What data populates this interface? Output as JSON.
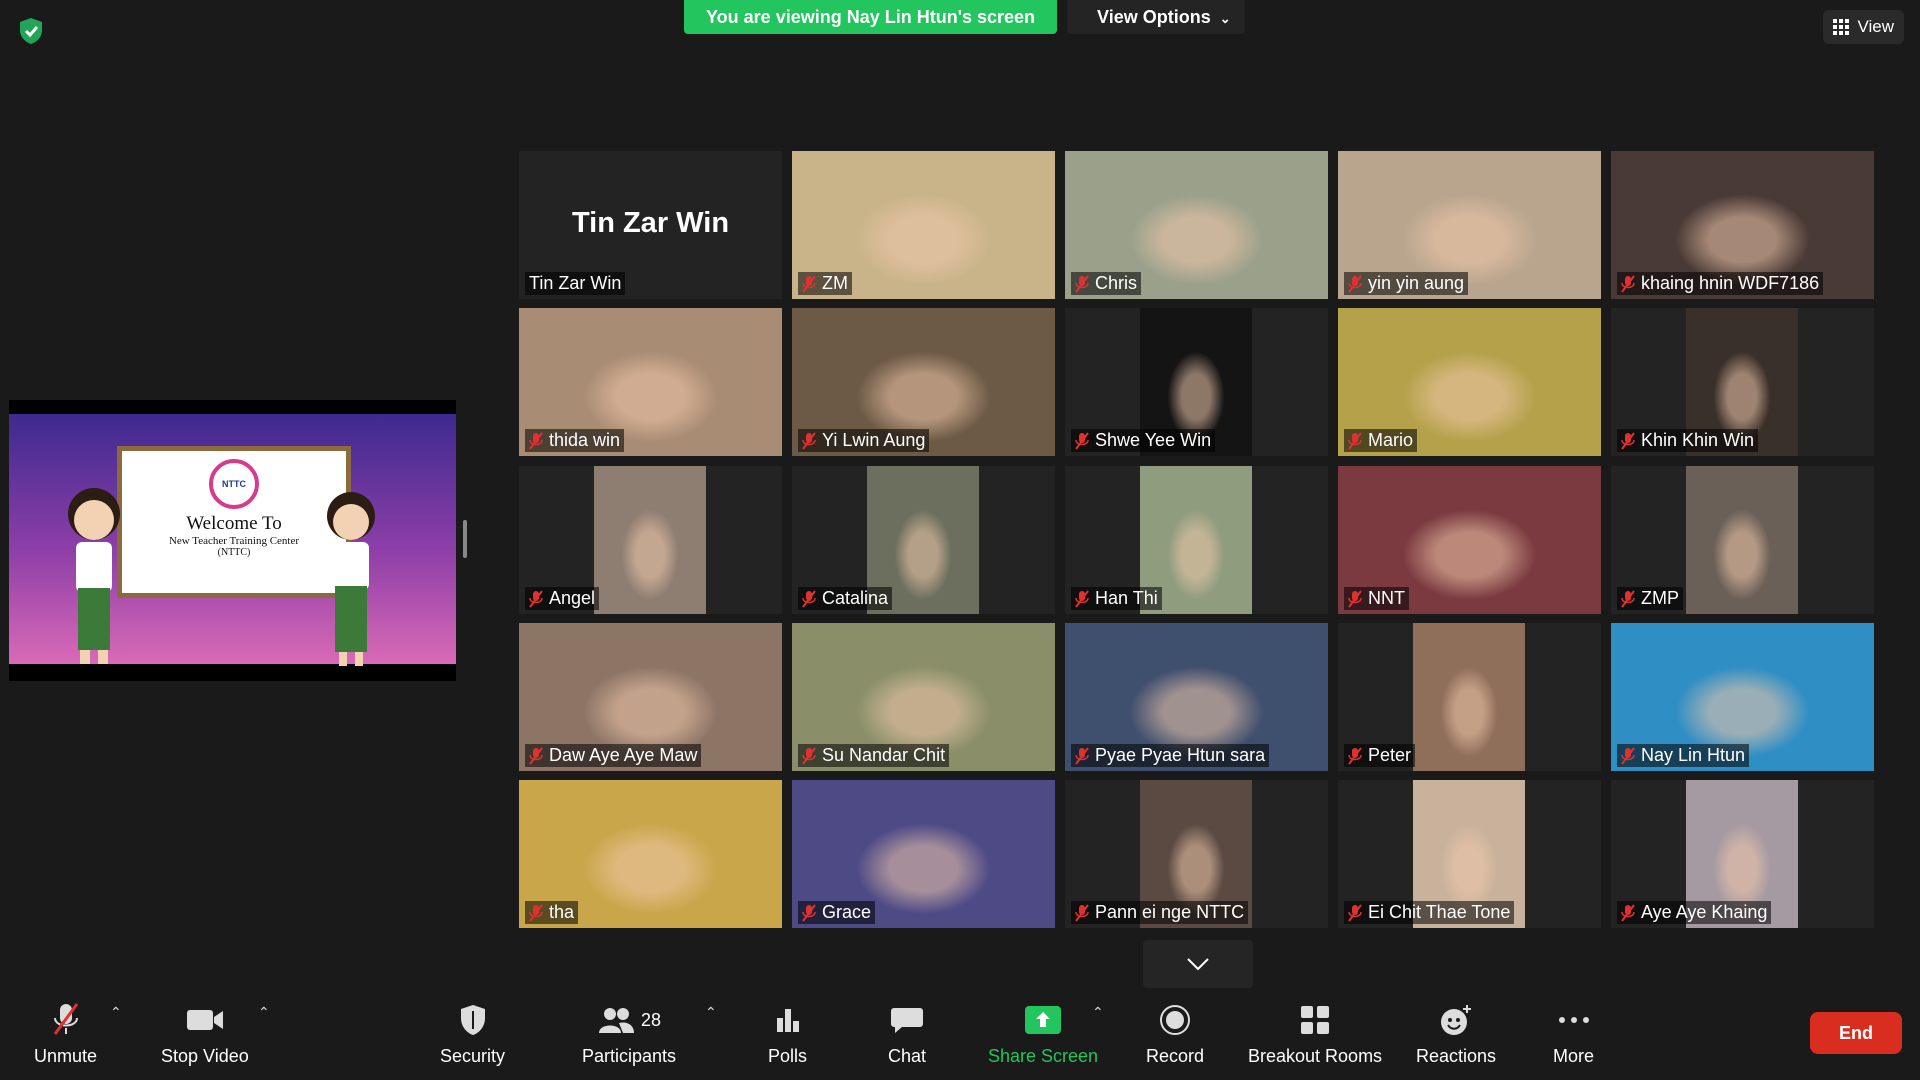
{
  "top": {
    "banner_text": "You are viewing Nay Lin Htun's screen",
    "view_options_label": "View Options",
    "view_label": "View"
  },
  "shared_slide": {
    "logo_text": "NTTC",
    "welcome": "Welcome To",
    "center_name": "New Teacher Training Center",
    "abbrev": "(NTTC)"
  },
  "participants": [
    {
      "name": "Tin Zar Win",
      "big_name": "Tin Zar Win",
      "video": false,
      "muted": false,
      "bg": "#232323"
    },
    {
      "name": "ZM",
      "video": true,
      "muted": true,
      "speaking": true,
      "bg": "#c9b48a"
    },
    {
      "name": "Chris",
      "video": true,
      "muted": true,
      "bg": "#9aa08a"
    },
    {
      "name": "yin yin aung",
      "video": true,
      "muted": true,
      "bg": "#b9a58e"
    },
    {
      "name": "khaing hnin WDF7186",
      "video": true,
      "muted": true,
      "bg": "#4a3a36"
    },
    {
      "name": "thida win",
      "video": true,
      "muted": true,
      "bg": "#a98c74"
    },
    {
      "name": "Yi Lwin Aung",
      "video": true,
      "muted": true,
      "bg": "#6d5a45"
    },
    {
      "name": "Shwe Yee Win",
      "video": true,
      "muted": true,
      "bg": "#141414",
      "narrow": true
    },
    {
      "name": "Mario",
      "video": true,
      "muted": true,
      "bg": "#b4a14a"
    },
    {
      "name": "Khin Khin Win",
      "video": true,
      "muted": true,
      "bg": "#3a302a",
      "narrow": true
    },
    {
      "name": "Angel",
      "video": true,
      "muted": true,
      "bg": "#8e7e72",
      "narrow": true
    },
    {
      "name": "Catalina",
      "video": true,
      "muted": true,
      "bg": "#6c6f5e",
      "narrow": true
    },
    {
      "name": "Han Thi",
      "video": true,
      "muted": true,
      "bg": "#8f9c7e",
      "narrow": true
    },
    {
      "name": "NNT",
      "video": true,
      "muted": true,
      "bg": "#7a3a40"
    },
    {
      "name": "ZMP",
      "video": true,
      "muted": true,
      "bg": "#6b6058",
      "narrow": true
    },
    {
      "name": "Daw Aye Aye Maw",
      "video": true,
      "muted": true,
      "bg": "#8d7566"
    },
    {
      "name": "Su Nandar Chit",
      "video": true,
      "muted": true,
      "bg": "#8a8f6a"
    },
    {
      "name": "Pyae Pyae Htun  sara",
      "video": true,
      "muted": true,
      "bg": "#3f4f6e"
    },
    {
      "name": "Peter",
      "video": true,
      "muted": true,
      "bg": "#8f6e5a",
      "narrow": true
    },
    {
      "name": "Nay Lin Htun",
      "video": true,
      "muted": true,
      "bg": "#2f8ec4"
    },
    {
      "name": "tha",
      "video": true,
      "muted": true,
      "bg": "#c9a64a"
    },
    {
      "name": "Grace",
      "video": true,
      "muted": true,
      "bg": "#4d4a86"
    },
    {
      "name": "Pann ei nge NTTC",
      "video": true,
      "muted": true,
      "bg": "#5a4a42",
      "narrow": true
    },
    {
      "name": "Ei Chit Thae Tone",
      "video": true,
      "muted": true,
      "bg": "#c8b29c",
      "narrow": true
    },
    {
      "name": "Aye Aye Khaing",
      "video": true,
      "muted": true,
      "bg": "#a69aa2",
      "narrow": true
    }
  ],
  "toolbar": {
    "unmute": "Unmute",
    "stop_video": "Stop Video",
    "security": "Security",
    "participants": "Participants",
    "participant_count": "28",
    "polls": "Polls",
    "chat": "Chat",
    "share_screen": "Share Screen",
    "record": "Record",
    "breakout_rooms": "Breakout Rooms",
    "reactions": "Reactions",
    "more": "More",
    "end": "End"
  },
  "colors": {
    "accent_green": "#22c55e",
    "speaker_outline": "#e6e600",
    "end_red": "#d92d20",
    "mute_red": "#e03131"
  }
}
